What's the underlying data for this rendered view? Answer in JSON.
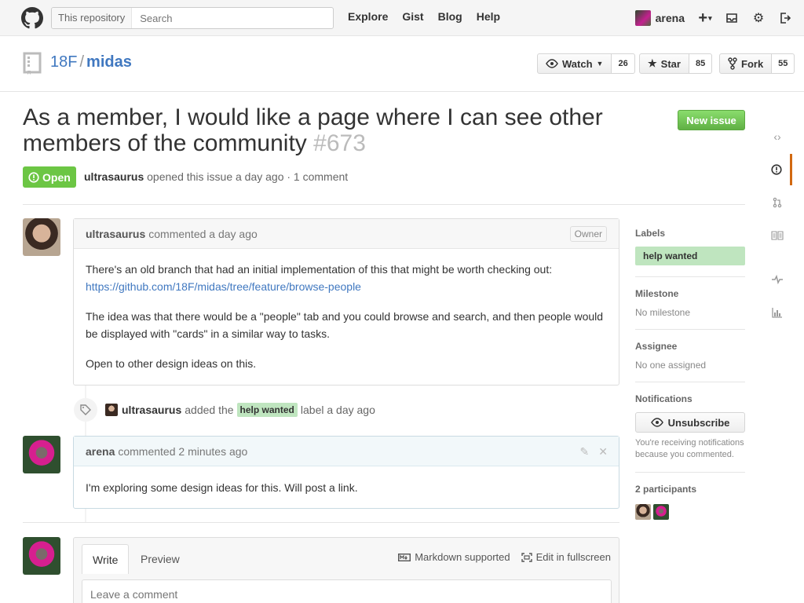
{
  "header": {
    "search_scope": "This repository",
    "search_placeholder": "Search",
    "nav": [
      "Explore",
      "Gist",
      "Blog",
      "Help"
    ],
    "username": "arena"
  },
  "repo": {
    "owner": "18F",
    "separator": "/",
    "name": "midas",
    "watch_label": "Watch",
    "watch_count": "26",
    "star_label": "Star",
    "star_count": "85",
    "fork_label": "Fork",
    "fork_count": "55"
  },
  "issue": {
    "title": "As a member, I would like a page where I can see other members of the community",
    "number": "#673",
    "state": "Open",
    "author": "ultrasaurus",
    "meta_rest": "opened this issue a day ago · 1 comment",
    "new_issue_label": "New issue"
  },
  "comments": [
    {
      "author": "ultrasaurus",
      "meta": "commented a day ago",
      "badge": "Owner",
      "paragraph1": "There's an old branch that had an initial implementation of this that might be worth checking out:",
      "link": "https://github.com/18F/midas/tree/feature/browse-people",
      "paragraph2": "The idea was that there would be a \"people\" tab and you could browse and search, and then people would be displayed with \"cards\" in a similar way to tasks.",
      "paragraph3": "Open to other design ideas on this."
    },
    {
      "author": "arena",
      "meta": "commented 2 minutes ago",
      "body": "I'm exploring some design ideas for this. Will post a link."
    }
  ],
  "event": {
    "actor": "ultrasaurus",
    "text1": "added the",
    "label": "help wanted",
    "text2": "label a day ago"
  },
  "composer": {
    "tab_write": "Write",
    "tab_preview": "Preview",
    "markdown": "Markdown supported",
    "fullscreen": "Edit in fullscreen",
    "placeholder": "Leave a comment"
  },
  "sidebar": {
    "labels_title": "Labels",
    "label": "help wanted",
    "milestone_title": "Milestone",
    "milestone_value": "No milestone",
    "assignee_title": "Assignee",
    "assignee_value": "No one assigned",
    "notifications_title": "Notifications",
    "unsubscribe_label": "Unsubscribe",
    "notifications_note": "You're receiving notifications because you commented.",
    "participants_title": "2 participants"
  },
  "colors": {
    "open_state": "#6cc644",
    "new_issue": "#60b044",
    "label_help_wanted": "#bfe5bf",
    "link": "#4078c0",
    "rail_active": "#d26911"
  },
  "icons": [
    "octocat-icon",
    "plus-icon",
    "inbox-icon",
    "gear-icon",
    "signout-icon",
    "repo-icon",
    "eye-icon",
    "star-icon",
    "fork-icon",
    "alert-icon",
    "tag-icon",
    "pencil-icon",
    "close-icon",
    "markdown-icon",
    "fullscreen-icon",
    "code-icon",
    "issue-icon",
    "pull-request-icon",
    "wiki-icon",
    "pulse-icon",
    "graph-icon"
  ]
}
